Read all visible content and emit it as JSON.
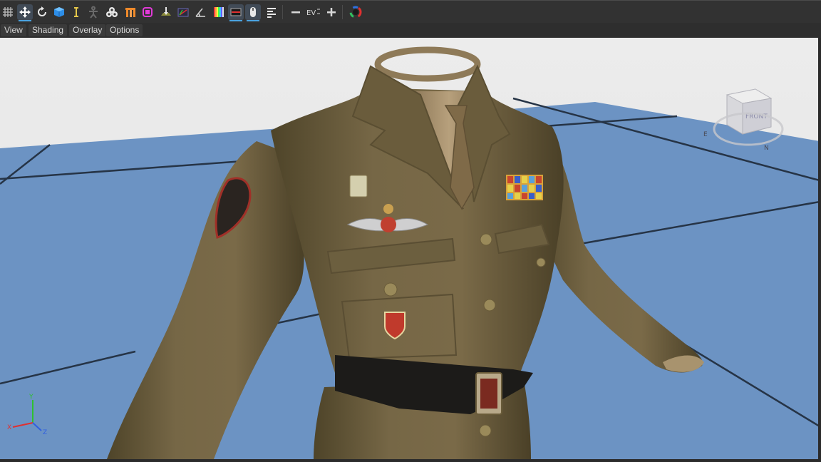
{
  "toolbar": {
    "tools": [
      {
        "name": "grid-icon",
        "active": false
      },
      {
        "name": "move-icon",
        "active": true
      },
      {
        "name": "rotate-icon",
        "active": false
      },
      {
        "name": "cube-icon",
        "active": false
      },
      {
        "name": "text-cursor-icon",
        "active": false
      },
      {
        "name": "figure-icon",
        "active": false
      },
      {
        "name": "group-icon",
        "active": false
      },
      {
        "name": "shelf-icon",
        "active": false
      },
      {
        "name": "magenta-cube-icon",
        "active": false
      },
      {
        "name": "floor-icon",
        "active": false
      },
      {
        "name": "rgb-box-icon",
        "active": false
      },
      {
        "name": "angle-icon",
        "active": false
      },
      {
        "name": "color-bars-icon",
        "active": false
      },
      {
        "name": "display-icon",
        "active": true
      },
      {
        "name": "mouse-icon",
        "active": true
      },
      {
        "name": "align-left-icon",
        "active": false
      },
      {
        "name": "minus-icon",
        "active": false
      },
      {
        "name": "ev-icon",
        "active": false
      },
      {
        "name": "plus-icon",
        "active": false
      },
      {
        "name": "color-wheel-icon",
        "active": false
      }
    ],
    "ev_label": "EV"
  },
  "menu": {
    "view": "View",
    "shading": "Shading",
    "overlay": "Overlay",
    "options": "Options"
  },
  "viewport": {
    "nav_cube_label": "FRONT",
    "compass_n": "N",
    "compass_e": "E",
    "axis_x": "X",
    "axis_y": "Y",
    "axis_z": "Z",
    "colors": {
      "background": "#e6e6e6",
      "floor": "#6b93c4",
      "grid_line": "#243142",
      "fabric": "#6f6140",
      "fabric_dark": "#4a4028",
      "belt": "#1c1b19",
      "axis_x": "#e03030",
      "axis_y": "#30c030",
      "axis_z": "#3060e0"
    }
  }
}
